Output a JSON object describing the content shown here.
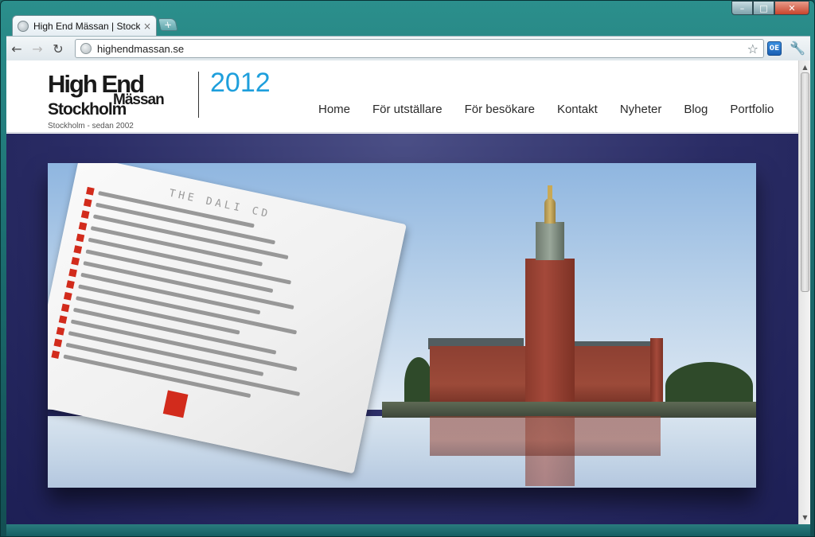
{
  "browser": {
    "tab": {
      "title": "High End Mässan | Stockho",
      "close": "×"
    },
    "new_tab": "+",
    "window_controls": {
      "minimize": "–",
      "maximize": "□",
      "close": "✕"
    },
    "nav": {
      "back": "←",
      "forward": "→",
      "reload": "↻"
    },
    "omnibox": {
      "url": "highendmassan.se"
    },
    "star": "☆",
    "extension": "0E",
    "wrench": "🔧"
  },
  "site": {
    "logo": {
      "line1": "High End",
      "line2": "Mässan",
      "line3": "Stockholm",
      "year": "2012",
      "year_color": "#1e9fdc"
    },
    "tagline": "Stockholm - sedan 2002",
    "nav": [
      {
        "label": "Home"
      },
      {
        "label": "För utställare"
      },
      {
        "label": "För besökare"
      },
      {
        "label": "Kontakt"
      },
      {
        "label": "Nyheter"
      },
      {
        "label": "Blog"
      },
      {
        "label": "Portfolio"
      }
    ],
    "hero": {
      "cd_title": "THE DALI CD"
    }
  },
  "colors": {
    "hero_background": "#2b2d66",
    "accent": "#1e9fdc",
    "cd_red": "#d22b1c"
  }
}
